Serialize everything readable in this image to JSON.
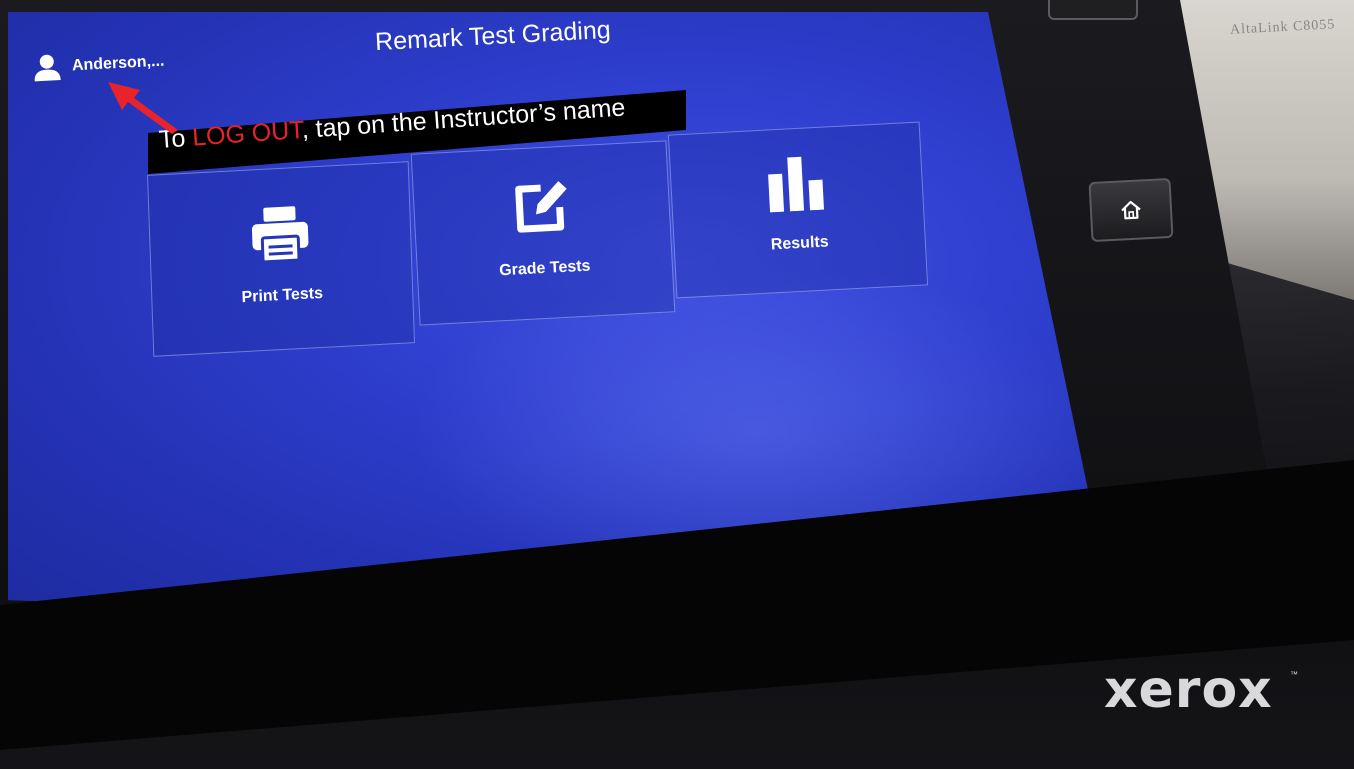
{
  "app": {
    "title": "Remark Test Grading",
    "user_name": "Anderson,..."
  },
  "caption": {
    "prefix": "To ",
    "highlight": "LOG OUT",
    "suffix": ", tap on the Instructor’s name",
    "highlight_color": "#e8232a"
  },
  "tiles": [
    {
      "label": "Print Tests",
      "icon": "printer-icon"
    },
    {
      "label": "Grade Tests",
      "icon": "edit-icon"
    },
    {
      "label": "Results",
      "icon": "bar-chart-icon"
    }
  ],
  "device": {
    "home_button_icon": "home-icon",
    "brand": "xerox",
    "brand_tm": "™",
    "wall_sign": "AltaLink C8055"
  },
  "colors": {
    "screen_blue": "#2f3fcf",
    "arrow_red": "#e8232a"
  }
}
